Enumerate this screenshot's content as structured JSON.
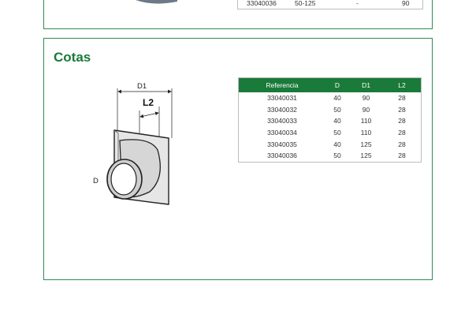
{
  "top_table": {
    "row": {
      "ref": "33040036",
      "range": "50-125",
      "dash": "-",
      "value": "90"
    }
  },
  "cotas": {
    "title": "Cotas",
    "drawing": {
      "label_d1": "D1",
      "label_l2": "L2",
      "label_d": "D"
    },
    "table": {
      "headers": {
        "ref": "Referencia",
        "d": "D",
        "d1": "D1",
        "l2": "L2"
      },
      "rows": [
        {
          "ref": "33040031",
          "d": "40",
          "d1": "90",
          "l2": "28"
        },
        {
          "ref": "33040032",
          "d": "50",
          "d1": "90",
          "l2": "28"
        },
        {
          "ref": "33040033",
          "d": "40",
          "d1": "110",
          "l2": "28"
        },
        {
          "ref": "33040034",
          "d": "50",
          "d1": "110",
          "l2": "28"
        },
        {
          "ref": "33040035",
          "d": "40",
          "d1": "125",
          "l2": "28"
        },
        {
          "ref": "33040036",
          "d": "50",
          "d1": "125",
          "l2": "28"
        }
      ]
    }
  },
  "colors": {
    "accent": "#1a7a3a",
    "border": "#2e8b57"
  }
}
